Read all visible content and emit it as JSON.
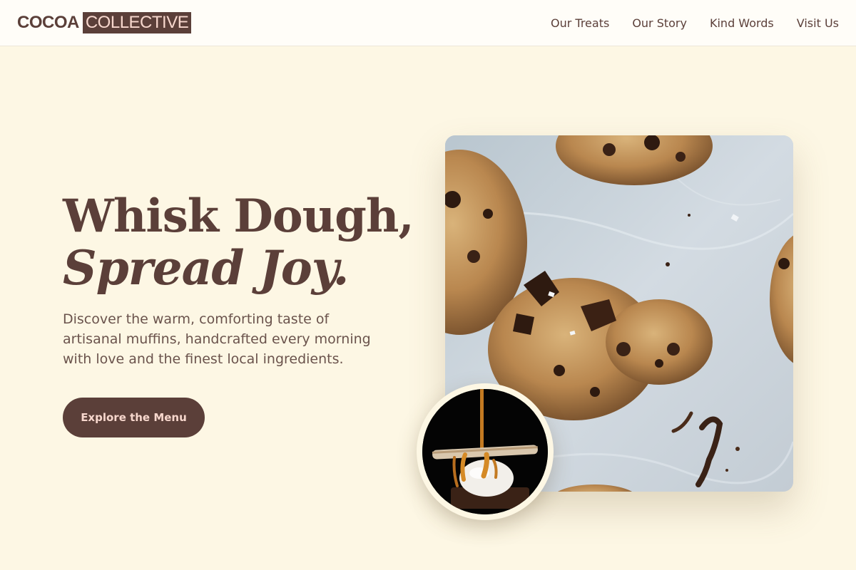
{
  "brand": {
    "logo_part1": "COCOA",
    "logo_part2": "COLLECTIVE"
  },
  "nav": {
    "items": [
      {
        "label": "Our Treats"
      },
      {
        "label": "Our Story"
      },
      {
        "label": "Kind Words"
      },
      {
        "label": "Visit Us"
      }
    ]
  },
  "hero": {
    "title_line1": "Whisk Dough,",
    "title_line2": "Spread Joy.",
    "description": "Discover the warm, comforting taste of artisanal muffins, handcrafted every morning with love and the finest local ingredients.",
    "cta_label": "Explore the Menu"
  },
  "images": {
    "main_photo": "chocolate-chip-cookies-photo",
    "inset_photo": "caramel-ice-cream-dessert-photo"
  },
  "colors": {
    "page_background": "#fdf7e4",
    "header_background": "#fffdf8",
    "primary_brown": "#5b3f39",
    "accent_pink": "#f7d7cd",
    "parchment_blue": "#c6d0d8"
  }
}
